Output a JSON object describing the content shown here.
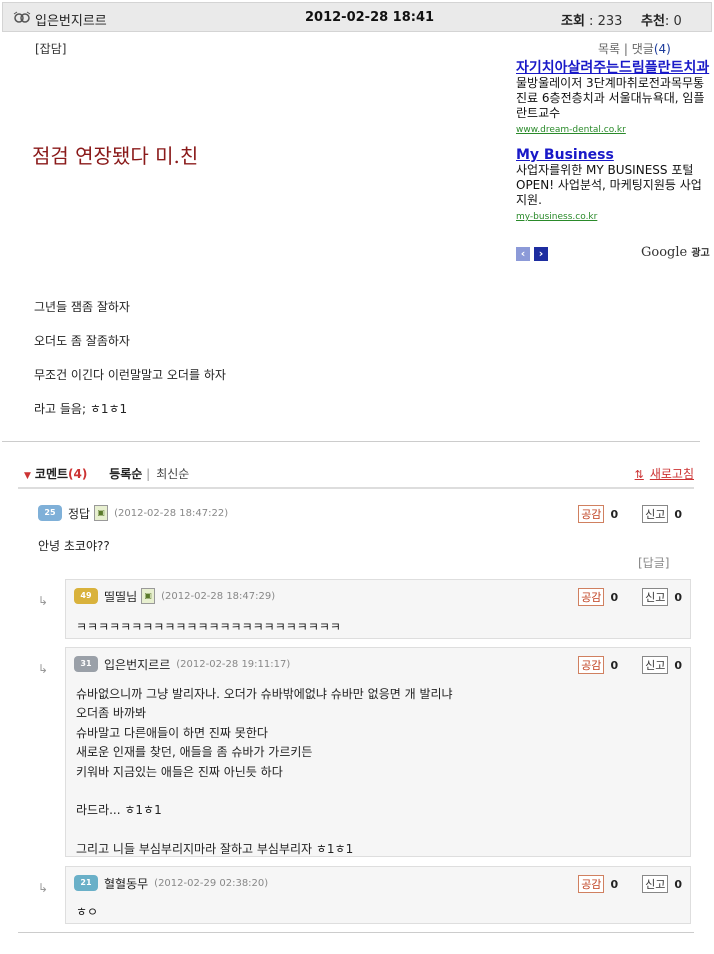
{
  "header": {
    "author": "입은번지르르",
    "datetime": "2012-02-28 18:41",
    "views_label": "조회",
    "views": "233",
    "recommend_label": "추천",
    "recommend": "0"
  },
  "post": {
    "category": "[잡담]",
    "list_link": "목록",
    "comments_link": "댓글",
    "comments_count": "(4)",
    "title": "점검 연장됐다 미.친",
    "lines": [
      "그년들 잼좀 잘하자",
      "오더도 좀 잘좀하자",
      "무조건 이긴다 이런말말고 오더를 하자",
      "라고 들음; ㅎ1ㅎ1"
    ]
  },
  "ads": {
    "items": [
      {
        "title": "자기치아살려주는드림플란트치과",
        "desc": "물방울레이저 3단계마취로전과목무통진료 6층전층치과 서울대뉴욕대, 임플란트교수",
        "url": "www.dream-dental.co.kr"
      },
      {
        "title": "My Business",
        "desc": "사업자를위한 MY BUSINESS 포털 OPEN! 사업분석, 마케팅지원등 사업지원.",
        "url": "my-business.co.kr"
      }
    ],
    "provider": "Google",
    "provider_suffix": "광고"
  },
  "comments_header": {
    "label": "코멘트",
    "count": "(4)",
    "sort_registered": "등록순",
    "sort_latest": "최신순",
    "refresh": "새로고침"
  },
  "comments": [
    {
      "level": "25",
      "name": "정답",
      "time": "(2012-02-28 18:47:22)",
      "like_label": "공감",
      "likes": "0",
      "report_label": "신고",
      "reports": "0",
      "text": "안녕 초코야??",
      "reply_label": "[답글]"
    },
    {
      "level": "49",
      "name": "띨띨님",
      "time": "(2012-02-28 18:47:29)",
      "like_label": "공감",
      "likes": "0",
      "report_label": "신고",
      "reports": "0",
      "text": "ㅋㅋㅋㅋㅋㅋㅋㅋㅋㅋㅋㅋㅋㅋㅋㅋㅋㅋㅋㅋㅋㅋㅋㅋ"
    },
    {
      "level": "31",
      "name": "입은번지르르",
      "time": "(2012-02-28 19:11:17)",
      "like_label": "공감",
      "likes": "0",
      "report_label": "신고",
      "reports": "0",
      "text": "슈바없으니까 그냥 발리자나. 오더가 슈바밖에없냐 슈바만 없응면 개 발리냐\n오더좀 바까봐\n슈바말고 다른애들이 하면 진짜 못한다\n새로운 인재를 찾던, 애들을 좀 슈바가 가르키든\n키워바 지금있는 애들은 진짜 아닌듯 하다\n\n라드라... ㅎ1ㅎ1\n\n그리고 니들 부심부리지마라 잘하고 부심부리자 ㅎ1ㅎ1"
    },
    {
      "level": "21",
      "name": "혈혈동무",
      "time": "(2012-02-29 02:38:20)",
      "like_label": "공감",
      "likes": "0",
      "report_label": "신고",
      "reports": "0",
      "text": "ㅎㅇ"
    }
  ]
}
